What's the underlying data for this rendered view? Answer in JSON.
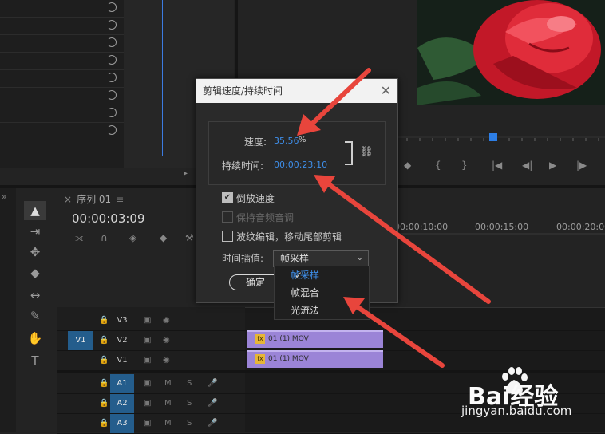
{
  "effect_controls": {
    "rows": 8
  },
  "program_monitor": {
    "transport_icons": [
      "add-marker-icon",
      "in-point-icon",
      "out-point-icon",
      "go-to-in-icon",
      "step-back-icon",
      "play-icon",
      "step-forward-icon"
    ]
  },
  "timeline": {
    "sequence_tab": "序列 01",
    "timecode": "00:00:03:09",
    "ruler_labels": [
      "00:00:10:00",
      "00:00:15:00",
      "00:00:20:00"
    ],
    "tracks": [
      {
        "name": "V3",
        "target": ""
      },
      {
        "name": "V2",
        "target": "V1"
      },
      {
        "name": "V1",
        "target": ""
      },
      {
        "name": "A1",
        "target": ""
      },
      {
        "name": "A2",
        "target": ""
      },
      {
        "name": "A3",
        "target": ""
      }
    ],
    "clips": [
      {
        "label": "01 (1).MOV",
        "track": "V2"
      },
      {
        "label": "01 (1).MOV",
        "track": "V1"
      }
    ],
    "mute_label": "M",
    "solo_label": "S"
  },
  "dialog": {
    "title": "剪辑速度/持续时间",
    "speed_label": "速度:",
    "speed_value": "35.56",
    "speed_unit": "%",
    "duration_label": "持续时间:",
    "duration_value": "00:00:23:10",
    "reverse_label": "倒放速度",
    "reverse_checked": true,
    "maintain_audio_label": "保持音频音调",
    "ripple_label": "波纹编辑，移动尾部剪辑",
    "interp_label": "时间插值:",
    "interp_value": "帧采样",
    "ok_label": "确定"
  },
  "dropdown": {
    "options": [
      "帧采样",
      "帧混合",
      "光流法"
    ],
    "selected": "帧采样"
  },
  "watermark": {
    "brand": "Bai经验",
    "url": "jingyan.baidu.com"
  },
  "colors": {
    "accent_blue": "#3e8ee9",
    "clip_purple": "#9b84d7",
    "arrow_red": "#e8453c"
  }
}
